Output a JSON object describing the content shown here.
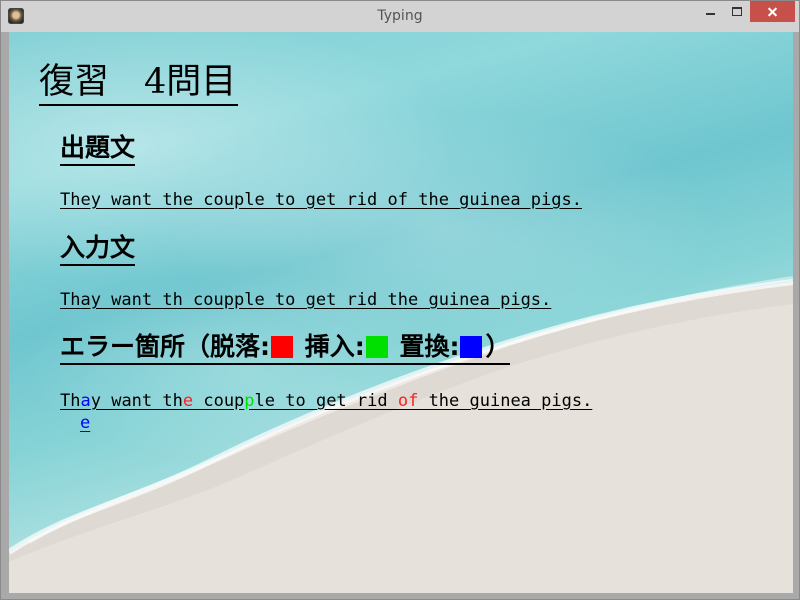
{
  "window": {
    "title": "Typing"
  },
  "lesson": {
    "title": "復習　4問目"
  },
  "sections": {
    "problem_heading": "出題文",
    "input_heading": "入力文",
    "error_heading_prefix": "エラー箇所（脱落:",
    "error_heading_insert": "挿入:",
    "error_heading_replace": "置換:",
    "error_heading_suffix": "）"
  },
  "legend_colors": {
    "deletion": "#ff0000",
    "insertion": "#00e000",
    "replacement": "#0000ff"
  },
  "problem_sentence": "They want the couple to get rid of the guinea pigs.",
  "input_sentence": "Thay want th coupple to get rid the guinea pigs.",
  "error_line": {
    "p1": "Th",
    "replaced": "a",
    "p2": "y want th",
    "deleted1": "e",
    "p3": " coup",
    "inserted": "p",
    "p4": "le to get rid ",
    "deleted2": "of ",
    "p5": "the guinea pigs.",
    "correction": "e"
  }
}
